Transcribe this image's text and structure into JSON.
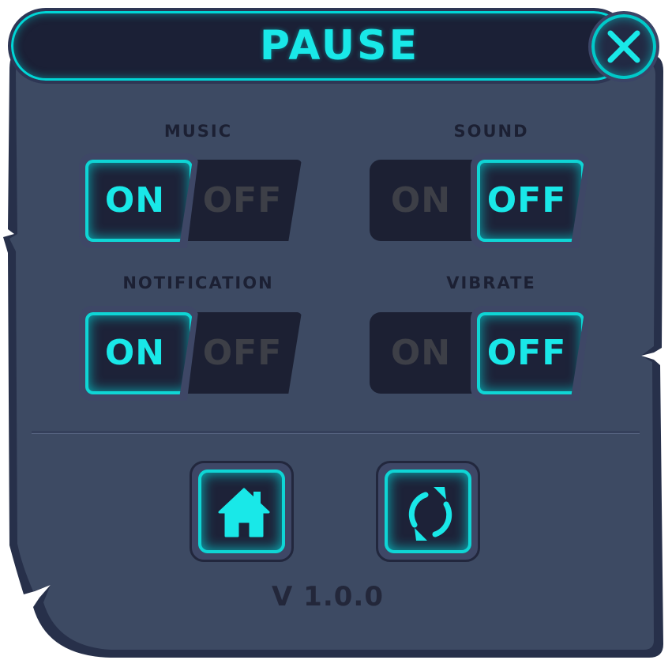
{
  "dialog": {
    "title": "PAUSE",
    "close_icon": "close-x-icon"
  },
  "settings": [
    {
      "label": "MUSIC",
      "on_label": "ON",
      "off_label": "OFF",
      "state": "ON"
    },
    {
      "label": "SOUND",
      "on_label": "ON",
      "off_label": "OFF",
      "state": "OFF"
    },
    {
      "label": "NOTIFICATION",
      "on_label": "ON",
      "off_label": "OFF",
      "state": "ON"
    },
    {
      "label": "VIBRATE",
      "on_label": "ON",
      "off_label": "OFF",
      "state": "OFF"
    }
  ],
  "actions": {
    "home_icon": "home-icon",
    "restart_icon": "restart-icon"
  },
  "version": "V 1.0.0",
  "colors": {
    "panel": "#3d4a63",
    "panel_border": "#26304a",
    "accent_glow": "#19e8e8",
    "dark_fill": "#1c2033",
    "inactive_text": "#3d3f47"
  }
}
